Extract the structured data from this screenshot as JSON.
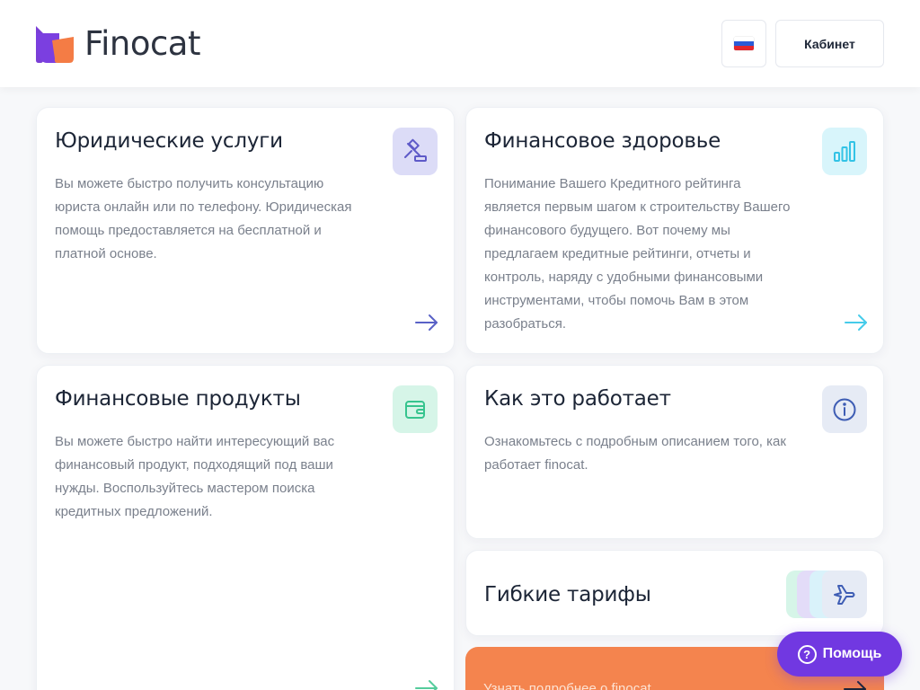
{
  "header": {
    "brand": "Finocat",
    "language": "ru",
    "cabinet_label": "Кабинет"
  },
  "cards": {
    "legal": {
      "title": "Юридические услуги",
      "text": "Вы можете быстро получить консультацию юриста онлайн или по телефону. Юридическая помощь предоставляется на бесплатной и платной основе.",
      "icon": "gavel-icon",
      "accent": "#6b63d6"
    },
    "health": {
      "title": "Финансовое здоровье",
      "text": "Понимание Вашего Кредитного рейтинга является первым шагом к строительству Вашего финансового будущего. Вот почему мы предлагаем кредитные рейтинги, отчеты и контроль, наряду с удобными финансовыми инструментами, чтобы помочь Вам в этом разобраться.",
      "icon": "bar-chart-icon",
      "accent": "#2bc0e4"
    },
    "products": {
      "title": "Финансовые продукты",
      "text": "Вы можете быстро найти интересующий вас финансовый продукт, подходящий под ваши нужды. Воспользуйтесь мастером поиска кредитных предложений.",
      "icon": "wallet-icon",
      "accent": "#2fc48a"
    },
    "how": {
      "title": "Как это работает",
      "text": "Ознакомьтесь с подробным описанием того, как работает finocat.",
      "icon": "info-icon",
      "accent": "#4a63b8"
    },
    "tariffs": {
      "title": "Гибкие тарифы",
      "icon": "plane-icon",
      "accent": "#4a63b8"
    }
  },
  "cta": {
    "text": "Узнать подробнее о finocat"
  },
  "help": {
    "label": "Помощь",
    "color": "#7138e1"
  }
}
